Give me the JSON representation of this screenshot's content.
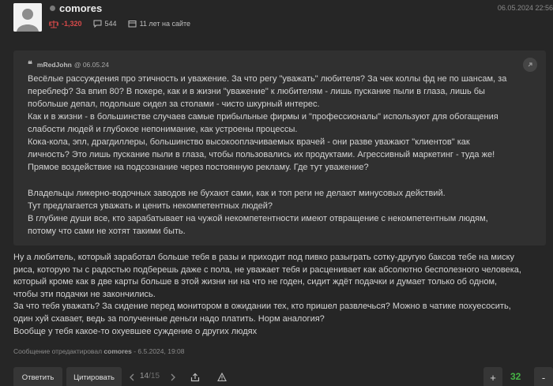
{
  "post": {
    "username": "comores",
    "date": "06.05.2024 22:56",
    "reputation": "-1,320",
    "messages": "544",
    "on_site": "11 лет на сайте"
  },
  "quote": {
    "author": "mRedJohn",
    "date": "@ 06.05.24",
    "paragraph1": [
      "Весёлые рассуждения про этичность и уважение. За что регу \"уважать\" любителя? За чек коллы фд не по шансам, за",
      "переблеф? За впип 80? В покере, как и в жизни \"уважение\" к любителям - лишь пускание пыли в глаза, лишь бы",
      "побольше депал, подольше сидел за столами - чисто шкурный интерес.",
      "Как и в жизни - в большинстве случаев самые прибыльные фирмы и \"профессионалы\" используют для обогащения",
      "слабости людей и глубокое непонимание, как устроены процессы.",
      "Кока-кола, эпл, драгдиллеры, большинство высокооплачиваемых врачей - они разве уважают \"клиентов\" как",
      "личность? Это лишь пускание пыли в глаза, чтобы пользовались их продуктами. Агрессивный маркетинг - туда же!",
      "Прямое воздействие на подсознание через постоянную рекламу. Где тут уважение?"
    ],
    "paragraph2": [
      "Владельцы ликерно-водочных заводов не бухают сами, как и топ реги не делают минусовых действий.",
      "Тут предлагается уважать и ценить некомпетентных людей?",
      "В глубине души все, кто зарабатывает на чужой некомпетентности имеют отвращение с некомпетентным людям,",
      "потому что сами не хотят такими быть."
    ]
  },
  "reply": [
    "Ну а любитель, который заработал больше тебя в разы и приходит под пивко разыграть сотку-другую баксов тебе на миску",
    "риса, которую ты с радостью подберешь даже с пола, не уважает тебя и расценивает как абсолютно бесполезного человека,",
    "который кроме как в две карты больше в этой жизни ни на что не годен, сидит ждёт подачки и думает только об одном,",
    "чтобы эти подачки не закончились.",
    "За что тебя уважать? За сидение перед монитором в ожидании тех, кто пришел развлечься? Можно в чатике похуесосить,",
    "один хуй схавает, ведь за полученные деньги надо платить. Норм аналогия?",
    "Вообще у тебя какое-то охуевшее суждение о других людях"
  ],
  "edited": {
    "prefix": "Сообщение отредактировал",
    "editor": "comores",
    "when": "- 6.5.2024, 19:08"
  },
  "actions": {
    "reply_label": "Ответить",
    "quote_label": "Цитировать",
    "page_current": "14",
    "page_total": "/15",
    "plus_label": "+",
    "minus_label": "-",
    "score": "32"
  },
  "colors": {
    "background": "#262626",
    "quote_background": "#303030",
    "negative": "#d94a4a",
    "positive": "#46b446"
  }
}
